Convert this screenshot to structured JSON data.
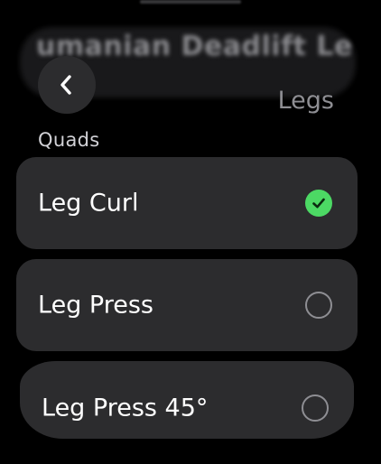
{
  "header": {
    "ghost_title": "umanian Deadlift     Le",
    "back_icon": "chevron-left-icon",
    "title": "Legs"
  },
  "section": {
    "label": "Quads"
  },
  "items": [
    {
      "label": "Leg Curl",
      "selected": true
    },
    {
      "label": "Leg Press",
      "selected": false
    },
    {
      "label": "Leg Press 45°",
      "selected": false
    }
  ],
  "colors": {
    "background": "#000000",
    "card": "#2c2c2e",
    "check_green": "#4cd964",
    "secondary_text": "#8e8e93"
  }
}
